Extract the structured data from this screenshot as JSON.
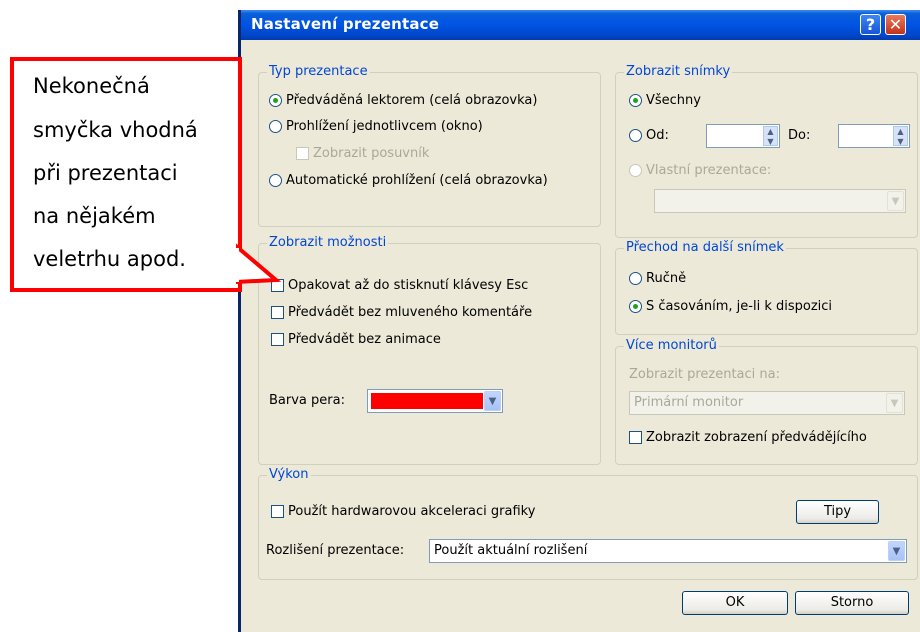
{
  "dialog": {
    "title": "Nastavení prezentace",
    "help": "?",
    "close": "✕"
  },
  "typ": {
    "legend": "Typ prezentace",
    "o1": "Předváděná lektorem (celá obrazovka)",
    "o2": "Prohlížení jednotlivcem (okno)",
    "o2_sub": "Zobrazit posuvník",
    "o3": "Automatické prohlížení (celá obrazovka)",
    "selected": "o1"
  },
  "snimky": {
    "legend": "Zobrazit snímky",
    "vsechny": "Všechny",
    "od": "Od:",
    "do": "Do:",
    "vlastni": "Vlastní prezentace:"
  },
  "moznosti": {
    "legend": "Zobrazit možnosti",
    "c1": "Opakovat až do stisknutí klávesy Esc",
    "c2": "Předvádět bez mluveného komentáře",
    "c3": "Předvádět bez animace",
    "barva_label": "Barva pera:",
    "barva_value": "#ff0000"
  },
  "prechod": {
    "legend": "Přechod na další snímek",
    "r1": "Ručně",
    "r2": "S časováním, je-li k dispozici"
  },
  "monitory": {
    "legend": "Více monitorů",
    "label": "Zobrazit prezentaci na:",
    "value": "Primární monitor",
    "check": "Zobrazit zobrazení předvádějícího"
  },
  "vykon": {
    "legend": "Výkon",
    "check": "Použít hardwarovou akceleraci grafiky",
    "tipy": "Tipy",
    "rozliseni_label": "Rozlišení prezentace:",
    "rozliseni_value": "Použít aktuální rozlišení"
  },
  "buttons": {
    "ok": "OK",
    "storno": "Storno"
  },
  "callout": {
    "lines": [
      "Nekonečná",
      "smyčka vhodná",
      "při prezentaci",
      "na nějakém",
      "veletrhu apod."
    ],
    "border_color": "#ff0000"
  }
}
